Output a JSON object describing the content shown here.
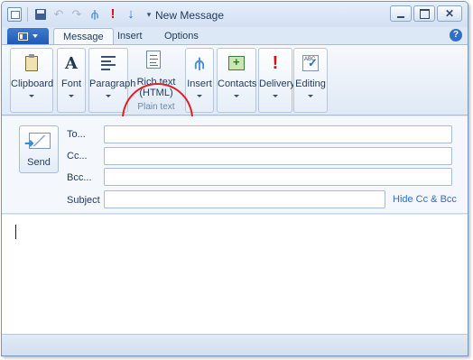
{
  "window": {
    "title": "New Message"
  },
  "qat": {
    "icons": [
      "app-icon",
      "save-icon",
      "undo-icon",
      "redo-icon",
      "attach-icon",
      "high-priority-icon",
      "low-priority-icon",
      "more-icon"
    ]
  },
  "tabs": [
    {
      "label": "Message",
      "active": true
    },
    {
      "label": "Insert",
      "active": false
    },
    {
      "label": "Options",
      "active": false
    }
  ],
  "ribbon": {
    "clipboard": "Clipboard",
    "font": "Font",
    "paragraph": "Paragraph",
    "richtext_line1": "Rich text",
    "richtext_line2": "(HTML)",
    "plaintext": "Plain text",
    "insert": "Insert",
    "contacts": "Contacts",
    "delivery": "Delivery",
    "editing": "Editing"
  },
  "compose": {
    "send_label": "Send",
    "to_label": "To...",
    "cc_label": "Cc...",
    "bcc_label": "Bcc...",
    "subject_label": "Subject",
    "to_value": "",
    "cc_value": "",
    "bcc_value": "",
    "subject_value": "",
    "hide_cc_bcc": "Hide Cc & Bcc"
  },
  "colors": {
    "accent": "#2f6fc9",
    "highlight_circle": "#e02020",
    "frame": "#dce8f6"
  }
}
